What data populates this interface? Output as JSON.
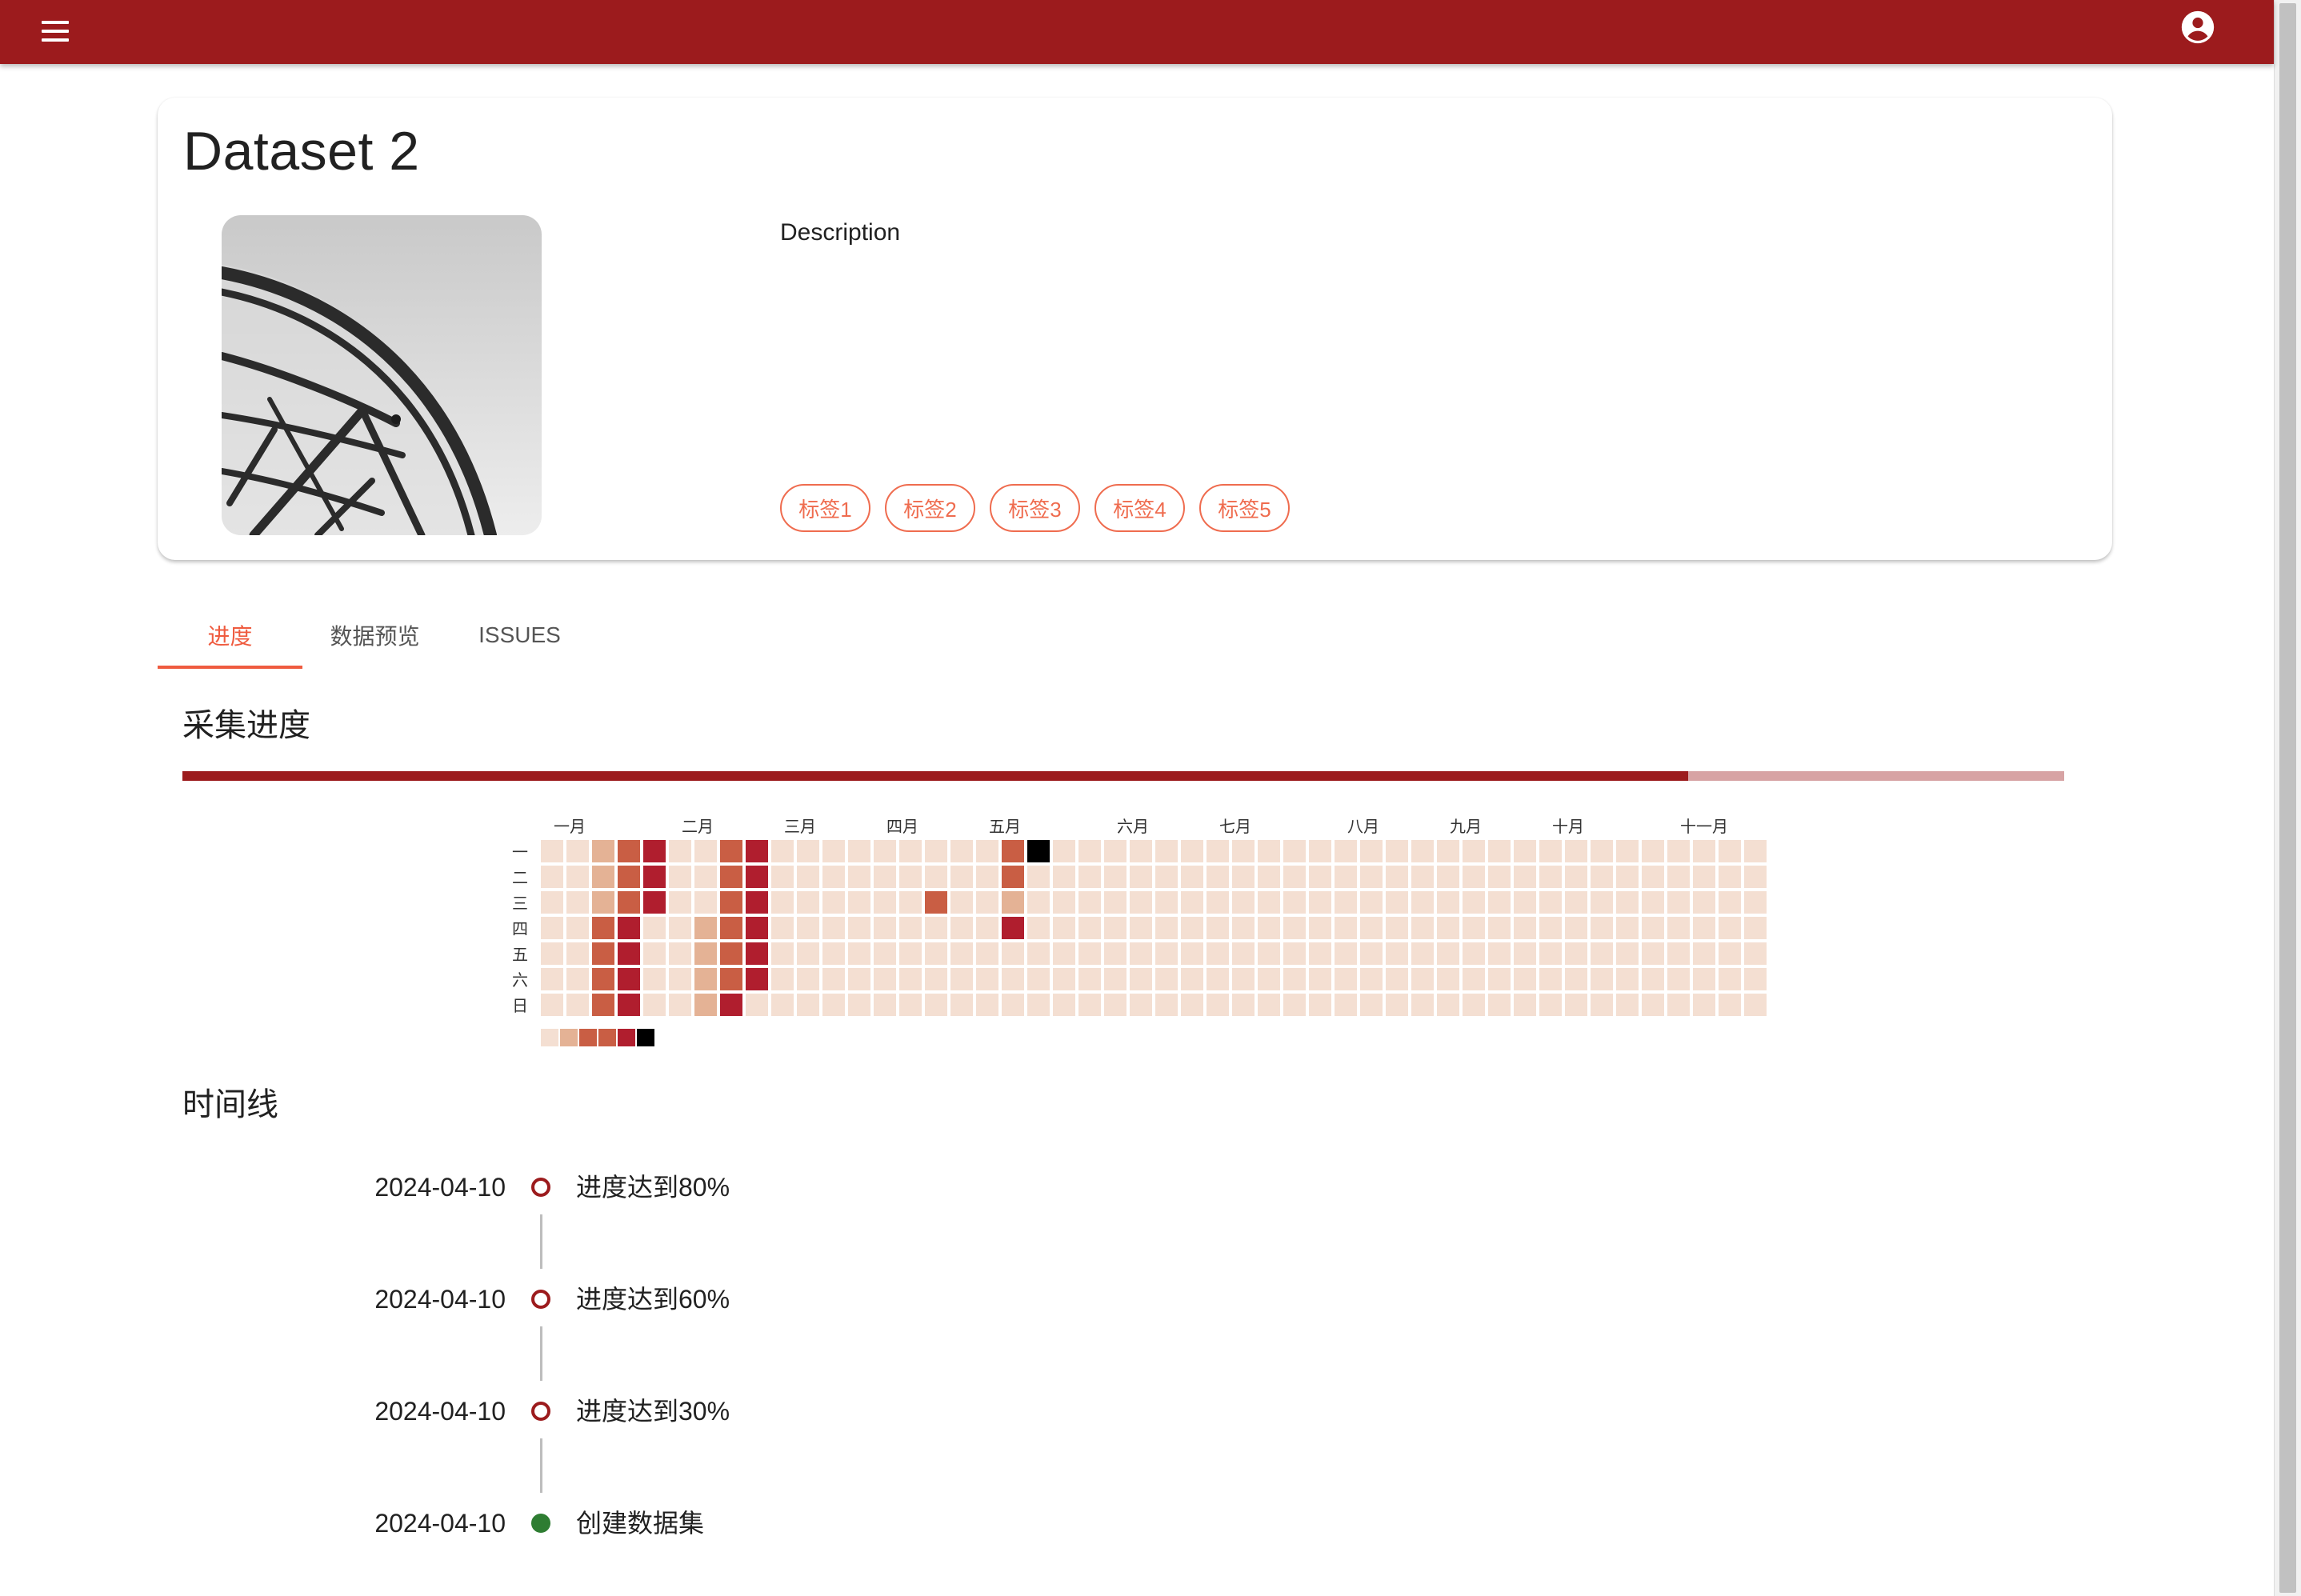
{
  "app_bar": {
    "menu_icon": "menu-icon",
    "account_icon": "account-circle-icon",
    "background": "#9c1b1d"
  },
  "dataset": {
    "title": "Dataset 2",
    "description_label": "Description",
    "tags": [
      "标签1",
      "标签2",
      "标签3",
      "标签4",
      "标签5"
    ]
  },
  "tabs": [
    {
      "label": "进度",
      "active": true
    },
    {
      "label": "数据预览",
      "active": false
    },
    {
      "label": "ISSUES",
      "active": false
    }
  ],
  "progress": {
    "title": "采集进度",
    "percent": 80
  },
  "heatmap": {
    "months": [
      "一月",
      "二月",
      "三月",
      "四月",
      "五月",
      "六月",
      "七月",
      "八月",
      "九月",
      "十月",
      "十一月"
    ],
    "weekdays": [
      "一",
      "二",
      "三",
      "四",
      "五",
      "六",
      "日"
    ],
    "colors": [
      "#f4dfd2",
      "#e4b295",
      "#c95e44",
      "#b01e2e",
      "#000000"
    ],
    "legend_levels": [
      0,
      1,
      2,
      2,
      3,
      4
    ],
    "weeks": 48,
    "active_cells": [
      [
        0,
        2,
        1
      ],
      [
        0,
        3,
        2
      ],
      [
        0,
        4,
        3
      ],
      [
        1,
        2,
        1
      ],
      [
        1,
        3,
        2
      ],
      [
        1,
        4,
        3
      ],
      [
        2,
        2,
        1
      ],
      [
        2,
        3,
        2
      ],
      [
        2,
        4,
        3
      ],
      [
        3,
        2,
        2
      ],
      [
        3,
        3,
        3
      ],
      [
        4,
        2,
        2
      ],
      [
        4,
        3,
        3
      ],
      [
        5,
        2,
        2
      ],
      [
        5,
        3,
        3
      ],
      [
        6,
        2,
        2
      ],
      [
        6,
        3,
        3
      ],
      [
        0,
        7,
        2
      ],
      [
        0,
        8,
        3
      ],
      [
        1,
        7,
        2
      ],
      [
        1,
        8,
        3
      ],
      [
        2,
        7,
        2
      ],
      [
        2,
        8,
        3
      ],
      [
        3,
        6,
        1
      ],
      [
        3,
        7,
        2
      ],
      [
        3,
        8,
        3
      ],
      [
        4,
        6,
        1
      ],
      [
        4,
        7,
        2
      ],
      [
        4,
        8,
        3
      ],
      [
        5,
        6,
        1
      ],
      [
        5,
        7,
        2
      ],
      [
        5,
        8,
        3
      ],
      [
        6,
        6,
        1
      ],
      [
        6,
        7,
        3
      ],
      [
        2,
        15,
        2
      ],
      [
        0,
        18,
        2
      ],
      [
        0,
        19,
        4
      ],
      [
        1,
        18,
        2
      ],
      [
        2,
        18,
        1
      ],
      [
        3,
        18,
        3
      ]
    ]
  },
  "timeline": {
    "title": "时间线",
    "events": [
      {
        "date": "2024-04-10",
        "text": "进度达到80%",
        "dot": "outline"
      },
      {
        "date": "2024-04-10",
        "text": "进度达到60%",
        "dot": "outline"
      },
      {
        "date": "2024-04-10",
        "text": "进度达到30%",
        "dot": "outline"
      },
      {
        "date": "2024-04-10",
        "text": "创建数据集",
        "dot": "filled"
      }
    ]
  }
}
